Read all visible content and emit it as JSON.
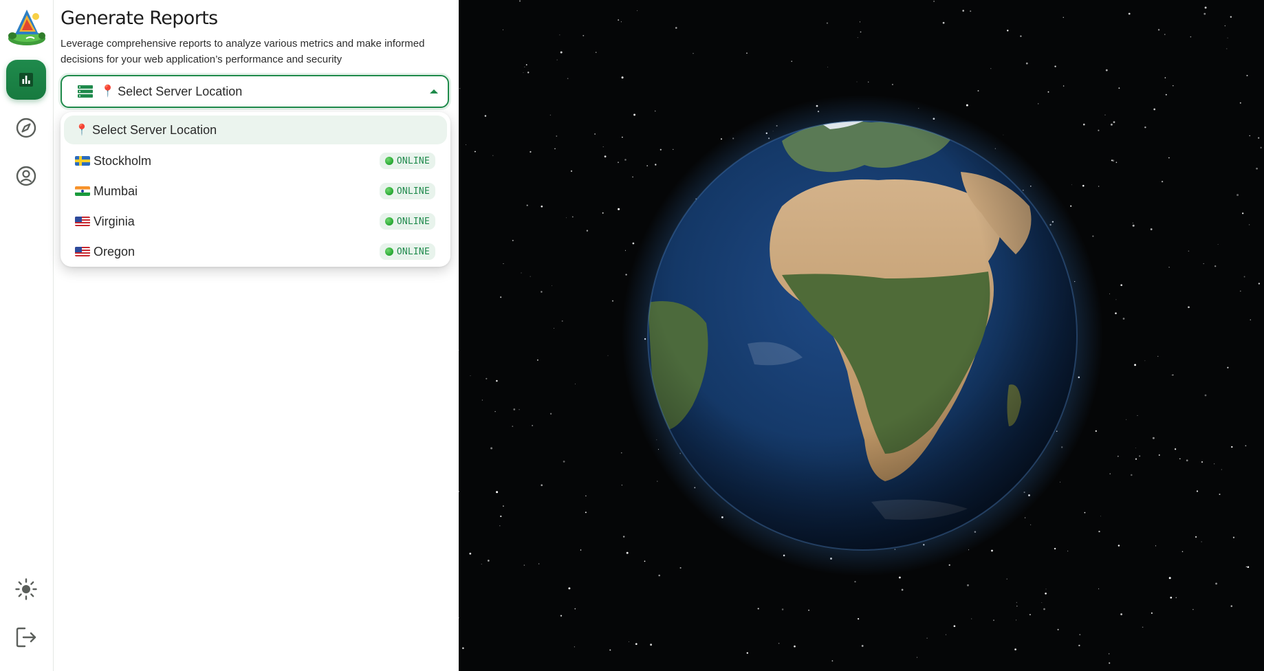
{
  "page": {
    "title": "Generate Reports",
    "description": "Leverage comprehensive reports to analyze various metrics and make informed decisions for your web application’s performance and security"
  },
  "rail": {
    "items": [
      {
        "icon": "bar-chart-icon",
        "active": true
      },
      {
        "icon": "compass-icon",
        "active": false
      },
      {
        "icon": "user-circle-icon",
        "active": false
      },
      {
        "icon": "sun-icon",
        "active": false
      },
      {
        "icon": "logout-icon",
        "active": false
      }
    ]
  },
  "server_select": {
    "icon": "server-icon",
    "pin": "📍",
    "value": "Select Server Location",
    "expanded": true,
    "options": [
      {
        "label": "Select Server Location",
        "pin": "📍",
        "status": "",
        "selected": true
      },
      {
        "label": "Stockholm",
        "flag": "se",
        "status": "ONLINE"
      },
      {
        "label": "Mumbai",
        "flag": "in",
        "status": "ONLINE"
      },
      {
        "label": "Virginia",
        "flag": "us",
        "status": "ONLINE"
      },
      {
        "label": "Oregon",
        "flag": "us",
        "status": "ONLINE"
      }
    ]
  },
  "colors": {
    "accent": "#1f8a4c",
    "status_bg": "#e8f3ec",
    "selected_option_bg": "#ebf4ee",
    "space_bg": "#050607"
  }
}
